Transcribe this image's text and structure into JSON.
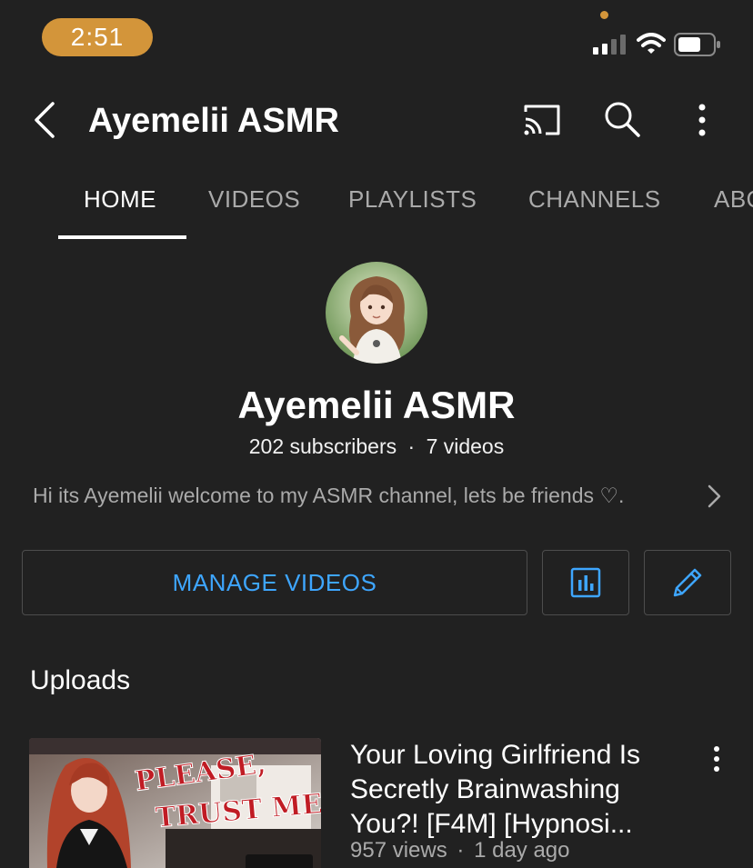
{
  "status_bar": {
    "time": "2:51"
  },
  "header": {
    "title": "Ayemelii ASMR"
  },
  "tabs": [
    {
      "label": "HOME",
      "active": true
    },
    {
      "label": "VIDEOS",
      "active": false
    },
    {
      "label": "PLAYLISTS",
      "active": false
    },
    {
      "label": "CHANNELS",
      "active": false
    },
    {
      "label": "ABO",
      "active": false
    }
  ],
  "profile": {
    "name": "Ayemelii ASMR",
    "subscribers": "202 subscribers",
    "separator": "·",
    "videos": "7 videos",
    "description": "Hi its Ayemelii welcome to my ASMR channel, lets be friends ♡."
  },
  "actions": {
    "manage_label": "MANAGE VIDEOS"
  },
  "uploads": {
    "title": "Uploads",
    "items": [
      {
        "title_lines": [
          "Your Loving Girlfriend Is",
          "Secretly Brainwashing",
          "You?! [F4M] [Hypnosi..."
        ],
        "views": "957 views",
        "separator": "·",
        "age": "1 day ago",
        "thumbnail_text": [
          "PLEASE,",
          "TRUST ME"
        ]
      }
    ]
  },
  "colors": {
    "background": "#212121",
    "accent_blue": "#3ea6ff",
    "status_orange": "#d3953a",
    "text_secondary": "#aaaaaa"
  },
  "icons": [
    "back-arrow-icon",
    "cast-icon",
    "search-icon",
    "more-vert-icon",
    "analytics-icon",
    "pencil-icon",
    "chevron-right-icon"
  ]
}
